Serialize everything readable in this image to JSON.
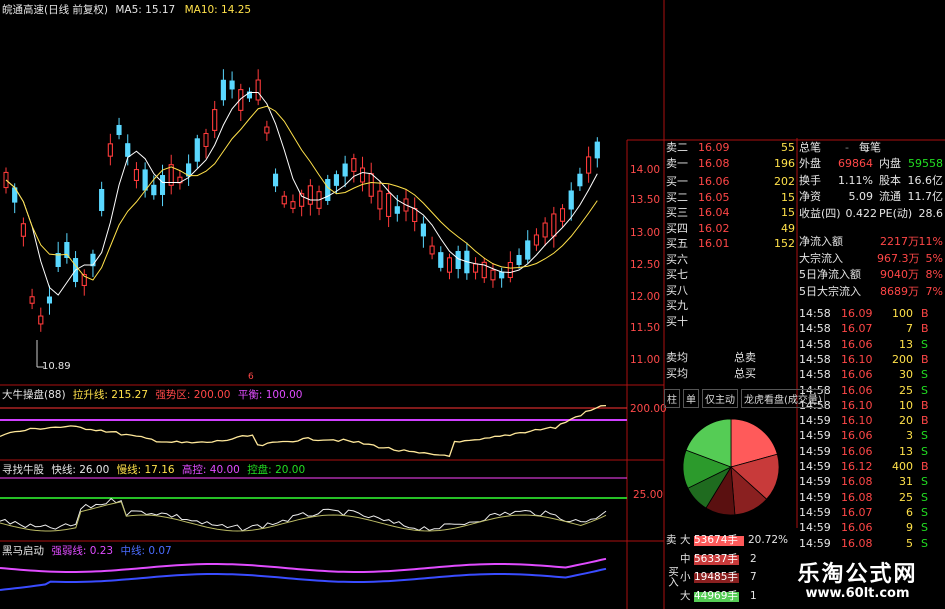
{
  "header": {
    "stock_title": "皖通高速(日线 前复权)",
    "ma5_label": "MA5: 15.17",
    "ma10_label": "MA10: 14.25"
  },
  "price_axis": {
    "ticks": [
      "14.00",
      "13.50",
      "13.00",
      "12.50",
      "12.00",
      "11.50",
      "11.00"
    ],
    "low_label": "10.89",
    "marker_label": "6"
  },
  "indicator1": {
    "name": "大牛操盘(88)",
    "line1": "拉升线: 215.27",
    "line2": "强势区: 200.00",
    "line3": "平衡: 100.00",
    "axis_label": "200.00"
  },
  "indicator2": {
    "name": "寻找牛股",
    "line1": "快线: 26.00",
    "line2": "慢线: 17.16",
    "line3": "高控: 40.00",
    "line4": "控盘: 20.00",
    "axis_label": "25.00"
  },
  "indicator3": {
    "name": "黑马启动",
    "line1": "强弱线: 0.23",
    "line2": "中线: 0.07"
  },
  "quote": {
    "weibi": "总笔",
    "weicha": "每笔",
    "sell": [
      {
        "label": "卖二",
        "price": "16.09",
        "vol": "55"
      },
      {
        "label": "卖一",
        "price": "16.08",
        "vol": "196"
      }
    ],
    "buy": [
      {
        "label": "买一",
        "price": "16.06",
        "vol": "202"
      },
      {
        "label": "买二",
        "price": "16.05",
        "vol": "15"
      },
      {
        "label": "买三",
        "price": "16.04",
        "vol": "15"
      },
      {
        "label": "买四",
        "price": "16.02",
        "vol": "49"
      },
      {
        "label": "买五",
        "price": "16.01",
        "vol": "152"
      },
      {
        "label": "买六",
        "price": "",
        "vol": ""
      },
      {
        "label": "买七",
        "price": "",
        "vol": ""
      },
      {
        "label": "买八",
        "price": "",
        "vol": ""
      },
      {
        "label": "买九",
        "price": "",
        "vol": ""
      },
      {
        "label": "买十",
        "price": "",
        "vol": ""
      }
    ],
    "sell_avg": "卖均",
    "buy_avg": "买均",
    "total_sell": "总卖",
    "total_buy": "总买"
  },
  "stats": [
    {
      "k": "外盘",
      "v": "69864",
      "k2": "内盘",
      "v2": "59558"
    },
    {
      "k": "换手",
      "v": "1.11%",
      "k2": "股本",
      "v2": "16.6亿"
    },
    {
      "k": "净资",
      "v": "5.09",
      "k2": "流通",
      "v2": "11.7亿"
    },
    {
      "k": "收益(四)",
      "v": "0.422",
      "k2": "PE(动)",
      "v2": "28.6"
    }
  ],
  "flows": [
    {
      "k": "净流入额",
      "v": "2217万",
      "p": "11%"
    },
    {
      "k": "大宗流入",
      "v": "967.3万",
      "p": "5%"
    },
    {
      "k": "5日净流入额",
      "v": "9040万",
      "p": "8%"
    },
    {
      "k": "5日大宗流入",
      "v": "8689万",
      "p": "7%"
    }
  ],
  "trades": [
    {
      "t": "14:58",
      "p": "16.09",
      "v": "100",
      "s": "B"
    },
    {
      "t": "14:58",
      "p": "16.07",
      "v": "7",
      "s": "B"
    },
    {
      "t": "14:58",
      "p": "16.06",
      "v": "13",
      "s": "S"
    },
    {
      "t": "14:58",
      "p": "16.10",
      "v": "200",
      "s": "B"
    },
    {
      "t": "14:58",
      "p": "16.06",
      "v": "30",
      "s": "S"
    },
    {
      "t": "14:58",
      "p": "16.06",
      "v": "25",
      "s": "S"
    },
    {
      "t": "14:58",
      "p": "16.10",
      "v": "10",
      "s": "B"
    },
    {
      "t": "14:59",
      "p": "16.10",
      "v": "20",
      "s": "B"
    },
    {
      "t": "14:59",
      "p": "16.06",
      "v": "3",
      "s": "S"
    },
    {
      "t": "14:59",
      "p": "16.06",
      "v": "13",
      "s": "S"
    },
    {
      "t": "14:59",
      "p": "16.12",
      "v": "400",
      "s": "B"
    },
    {
      "t": "14:59",
      "p": "16.08",
      "v": "31",
      "s": "S"
    },
    {
      "t": "14:59",
      "p": "16.08",
      "v": "25",
      "s": "S"
    },
    {
      "t": "14:59",
      "p": "16.07",
      "v": "6",
      "s": "S"
    },
    {
      "t": "14:59",
      "p": "16.06",
      "v": "9",
      "s": "S"
    },
    {
      "t": "14:59",
      "p": "16.08",
      "v": "5",
      "s": "S"
    }
  ],
  "tabs": [
    "柱",
    "单",
    "仅主动",
    "龙虎看盘(成交量)"
  ],
  "pie": {
    "slices": [
      {
        "value": 0.2072,
        "color": "#ff5a5a"
      },
      {
        "value": 0.16,
        "color": "#c83a3a"
      },
      {
        "value": 0.12,
        "color": "#8a2020"
      },
      {
        "value": 0.1,
        "color": "#5a1010"
      },
      {
        "value": 0.09,
        "color": "#1f6b1f"
      },
      {
        "value": 0.13,
        "color": "#2c9a2c"
      },
      {
        "value": 0.1928,
        "color": "#55cc55"
      }
    ]
  },
  "legend": {
    "buy_in_label": "买入",
    "sell_label": "卖",
    "rows": [
      {
        "size": "大",
        "value": "53674手",
        "pct": "20.72%",
        "color": "#ff5a5a"
      },
      {
        "size": "中",
        "value": "56337手",
        "pct": "2",
        "color": "#c83a3a"
      },
      {
        "size": "小",
        "value": "19485手",
        "pct": "7",
        "color": "#8a2020"
      },
      {
        "size": "大",
        "value": "44969手",
        "pct": "1",
        "color": "#55cc55"
      }
    ]
  },
  "brand": {
    "name": "乐淘公式网",
    "url": "www.60lt.com"
  }
}
